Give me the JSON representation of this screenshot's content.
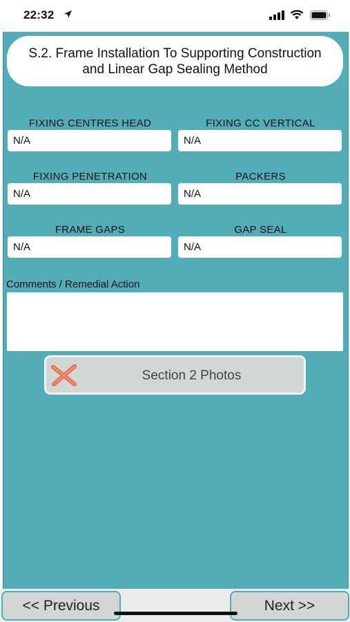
{
  "status_bar": {
    "time": "22:32"
  },
  "title": "S.2. Frame Installation To Supporting Construction and Linear Gap Sealing Method",
  "fields": [
    {
      "label": "FIXING CENTRES HEAD",
      "value": "N/A"
    },
    {
      "label": "FIXING CC VERTICAL",
      "value": "N/A"
    },
    {
      "label": "FIXING PENETRATION",
      "value": "N/A"
    },
    {
      "label": "PACKERS",
      "value": "N/A"
    },
    {
      "label": "FRAME GAPS",
      "value": "N/A"
    },
    {
      "label": "GAP SEAL",
      "value": "N/A"
    }
  ],
  "comments": {
    "label": "Comments / Remedial Action",
    "value": ""
  },
  "photos_button": {
    "label": "Section 2 Photos",
    "icon": "x-icon",
    "icon_color": "#e8694a"
  },
  "nav": {
    "previous_label": "<< Previous",
    "next_label": "Next >>"
  },
  "colors": {
    "background": "#53adb9",
    "button": "#d2d6d5"
  }
}
